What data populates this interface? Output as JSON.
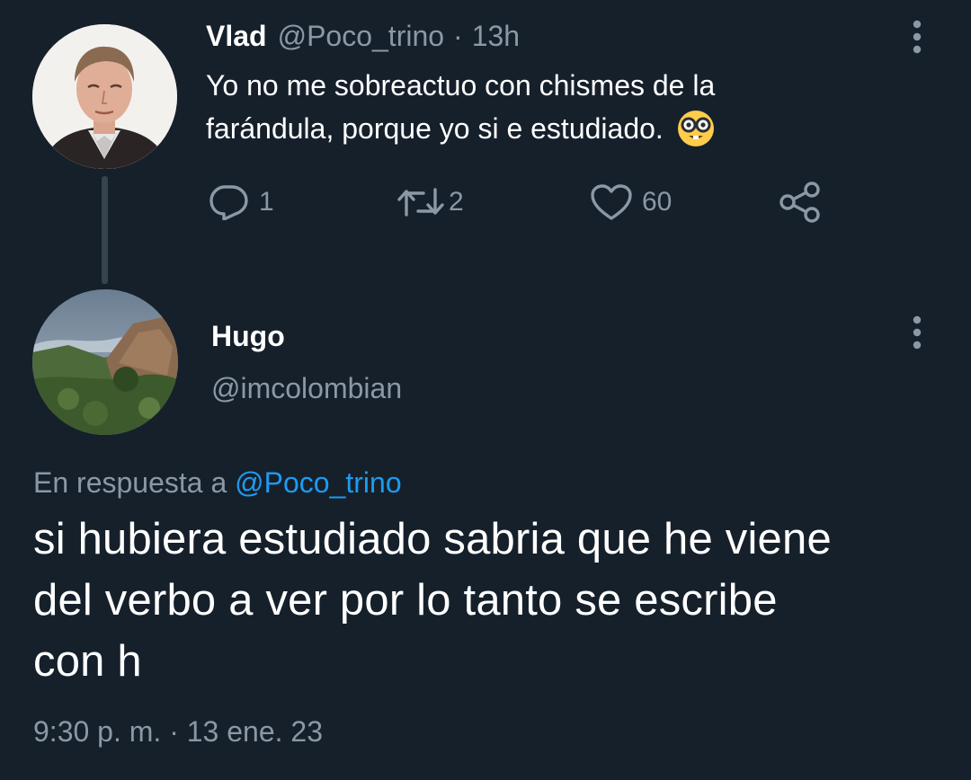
{
  "tweet": {
    "author_name": "Vlad",
    "author_handle": "@Poco_trino",
    "separator": "·",
    "time": "13h",
    "text_line1": "Yo no me sobreactuo con chismes de la",
    "text_line2": "farándula, porque yo si e estudiado.",
    "actions": {
      "replies": "1",
      "retweets": "2",
      "likes": "60"
    }
  },
  "reply": {
    "author_name": "Hugo",
    "author_handle": "@imcolombian",
    "in_reply_prefix": "En respuesta a",
    "in_reply_handle": "@Poco_trino",
    "text_line1": "si hubiera estudiado sabria que he viene",
    "text_line2": "del verbo a ver por lo tanto se escribe",
    "text_line3": "con h",
    "timestamp": "9:30 p. m. · 13 ene. 23"
  },
  "icons": [
    "more-icon",
    "reply-icon",
    "retweet-icon",
    "like-icon",
    "share-icon",
    "nerd-emoji-icon"
  ],
  "colors": {
    "background": "#15202b",
    "text_primary": "#ffffff",
    "text_secondary": "#8b98a5",
    "link": "#1d9bf0",
    "thread_line": "#38444d"
  }
}
